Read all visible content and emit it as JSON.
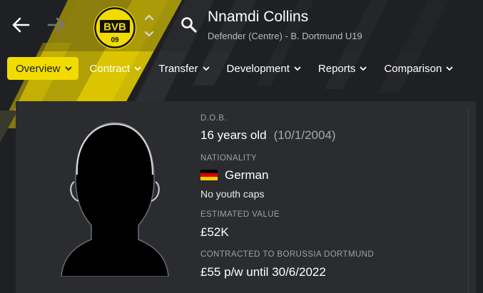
{
  "header": {
    "player_name": "Nnamdi Collins",
    "player_subtitle": "Defender (Centre) - B. Dortmund U19",
    "badge_text": "BVB",
    "badge_year": "09",
    "colors": {
      "accent": "#f2dc00",
      "background": "#1f2024",
      "panel": "#2a2c30"
    }
  },
  "nav": {
    "back_icon": "arrow-left-icon",
    "forward_icon": "arrow-right-icon",
    "search_icon": "search-icon"
  },
  "tabs": [
    {
      "label": "Overview",
      "active": true
    },
    {
      "label": "Contract",
      "active": false
    },
    {
      "label": "Transfer",
      "active": false
    },
    {
      "label": "Development",
      "active": false
    },
    {
      "label": "Reports",
      "active": false
    },
    {
      "label": "Comparison",
      "active": false
    }
  ],
  "profile": {
    "dob_label": "D.O.B.",
    "age": "16 years old",
    "dob": "(10/1/2004)",
    "nationality_label": "NATIONALITY",
    "nationality": "German",
    "youth_caps": "No youth caps",
    "value_label": "ESTIMATED VALUE",
    "value": "£52K",
    "contract_label": "CONTRACTED TO BORUSSIA DORTMUND",
    "contract": "£55 p/w until 30/6/2022"
  }
}
